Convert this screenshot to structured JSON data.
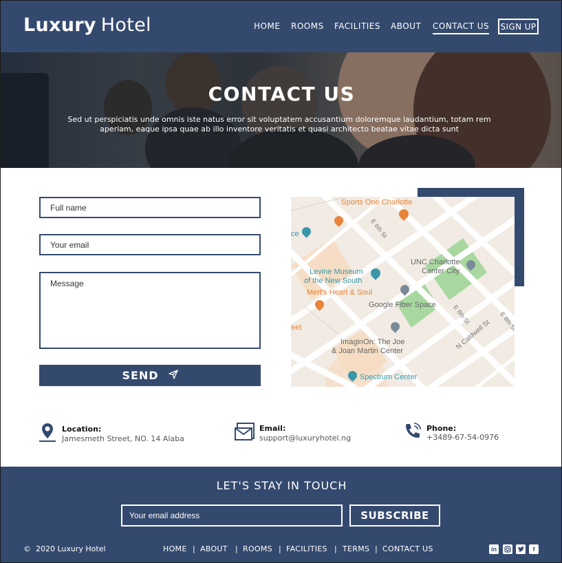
{
  "header": {
    "logo_bold": "Luxury",
    "logo_light": "Hotel",
    "nav": [
      "HOME",
      "ROOMS",
      "FACILITIES",
      "ABOUT",
      "CONTACT US"
    ],
    "active_nav": "CONTACT US",
    "signup_label": "SIGN UP"
  },
  "hero": {
    "title": "CONTACT US",
    "subtitle": "Sed ut perspiciatis unde omnis iste natus error sit voluptatem accusantium doloremque laudantium, totam rem aperiam, eaque ipsa quae ab illo inventore veritatis et quasi architecto  beatae vitae dicta sunt"
  },
  "form": {
    "name_placeholder": "Full name",
    "email_placeholder": "Your email",
    "message_placeholder": "Message",
    "send_label": "SEND"
  },
  "map": {
    "labels": {
      "sports": "Sports One Charlotte",
      "unc1": "UNC Charlotte",
      "unc2": "Center City",
      "levine1": "Levine Museum",
      "levine2": "of the New South",
      "merts": "Mert's Heart & Soul",
      "google": "Google Fiber Space",
      "imag1": "ImaginOn: The Joe",
      "imag2": "& Joan Martin Center",
      "spectrum": "Spectrum Center",
      "e6th": "E 6th St",
      "e8th": "E 8th St",
      "e8th2": "E 8th St",
      "caldwell": "N Caldwell St",
      "ce": "ce",
      "eet": "eet"
    }
  },
  "contact": {
    "location_label": "Location:",
    "location_value": "Jamesmeth Street, NO. 14 Alaba",
    "email_label": "Email:",
    "email_value": "support@luxuryhotel.ng",
    "phone_label": "Phone:",
    "phone_value": "+3489-67-54-0976"
  },
  "footer": {
    "title": "LET'S STAY IN TOUCH",
    "email_placeholder": "Your email address",
    "subscribe_label": "SUBSCRIBE",
    "copyright": "2020 Luxury Hotel",
    "links": [
      "HOME",
      "ABOUT",
      "ROOMS",
      "FACILITIES",
      "TERMS",
      "CONTACT US"
    ],
    "separator": "|",
    "social": [
      "linkedin-icon",
      "instagram-icon",
      "twitter-icon",
      "facebook-icon"
    ]
  },
  "colors": {
    "primary": "#34496e",
    "map_orange": "#e8833a",
    "map_teal": "#3a97a8",
    "map_park": "#a8d8a0"
  }
}
